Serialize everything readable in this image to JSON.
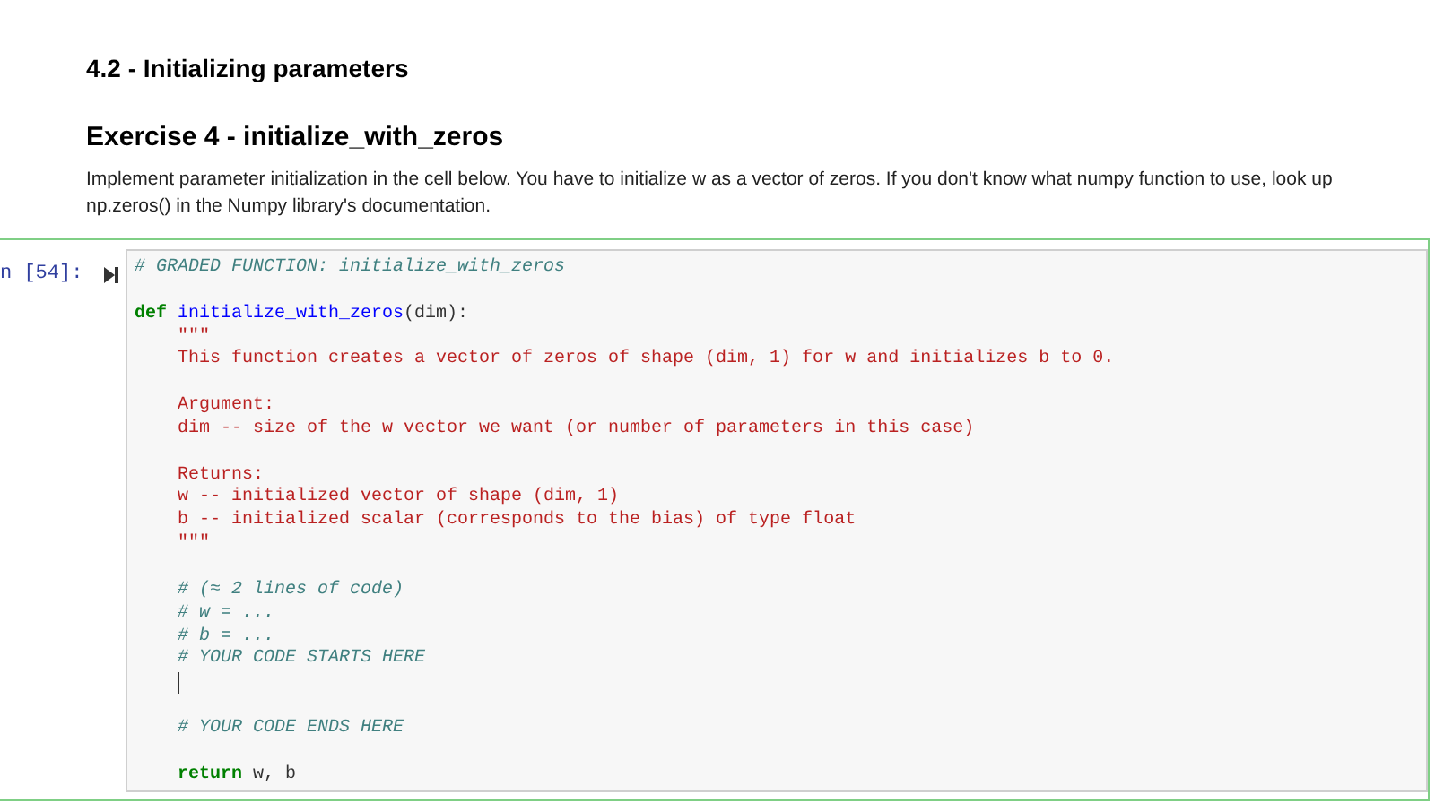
{
  "section_title": "4.2 - Initializing parameters",
  "exercise_title": "Exercise 4 - initialize_with_zeros",
  "instructions": "Implement parameter initialization in the cell below. You have to initialize w as a vector of zeros. If you don't know what numpy function to use, look up np.zeros() in the Numpy library's documentation.",
  "cell": {
    "prompt": "n [54]:",
    "lines": [
      {
        "kind": "code",
        "tokens": [
          {
            "kind": "comment",
            "text": "# GRADED FUNCTION: initialize_with_zeros"
          }
        ]
      },
      {
        "kind": "blank"
      },
      {
        "kind": "code",
        "tokens": [
          {
            "kind": "keyword",
            "text": "def"
          },
          {
            "kind": "name",
            "text": " initialize_with_zeros"
          },
          {
            "kind": "plain",
            "text": "(dim):"
          }
        ]
      },
      {
        "kind": "code",
        "tokens": [
          {
            "kind": "string",
            "text": "    \"\"\""
          }
        ]
      },
      {
        "kind": "code",
        "tokens": [
          {
            "kind": "string",
            "text": "    This function creates a vector of zeros of shape (dim, 1) for w and initializes b to 0."
          }
        ]
      },
      {
        "kind": "blank"
      },
      {
        "kind": "code",
        "tokens": [
          {
            "kind": "string",
            "text": "    Argument:"
          }
        ]
      },
      {
        "kind": "code",
        "tokens": [
          {
            "kind": "string",
            "text": "    dim -- size of the w vector we want (or number of parameters in this case)"
          }
        ]
      },
      {
        "kind": "blank"
      },
      {
        "kind": "code",
        "tokens": [
          {
            "kind": "string",
            "text": "    Returns:"
          }
        ]
      },
      {
        "kind": "code",
        "tokens": [
          {
            "kind": "string",
            "text": "    w -- initialized vector of shape (dim, 1)"
          }
        ]
      },
      {
        "kind": "code",
        "tokens": [
          {
            "kind": "string",
            "text": "    b -- initialized scalar (corresponds to the bias) of type float"
          }
        ]
      },
      {
        "kind": "code",
        "tokens": [
          {
            "kind": "string",
            "text": "    \"\"\""
          }
        ]
      },
      {
        "kind": "blank"
      },
      {
        "kind": "code",
        "tokens": [
          {
            "kind": "comment",
            "text": "    # (≈ 2 lines of code)"
          }
        ]
      },
      {
        "kind": "code",
        "tokens": [
          {
            "kind": "comment",
            "text": "    # w = ..."
          }
        ]
      },
      {
        "kind": "code",
        "tokens": [
          {
            "kind": "comment",
            "text": "    # b = ..."
          }
        ]
      },
      {
        "kind": "code",
        "tokens": [
          {
            "kind": "comment",
            "text": "    # YOUR CODE STARTS HERE"
          }
        ]
      },
      {
        "kind": "cursor"
      },
      {
        "kind": "blank"
      },
      {
        "kind": "code",
        "tokens": [
          {
            "kind": "comment",
            "text": "    # YOUR CODE ENDS HERE"
          }
        ]
      },
      {
        "kind": "blank"
      },
      {
        "kind": "code",
        "tokens": [
          {
            "kind": "keyword",
            "text": "    return"
          },
          {
            "kind": "plain",
            "text": " w, b"
          }
        ]
      }
    ]
  }
}
